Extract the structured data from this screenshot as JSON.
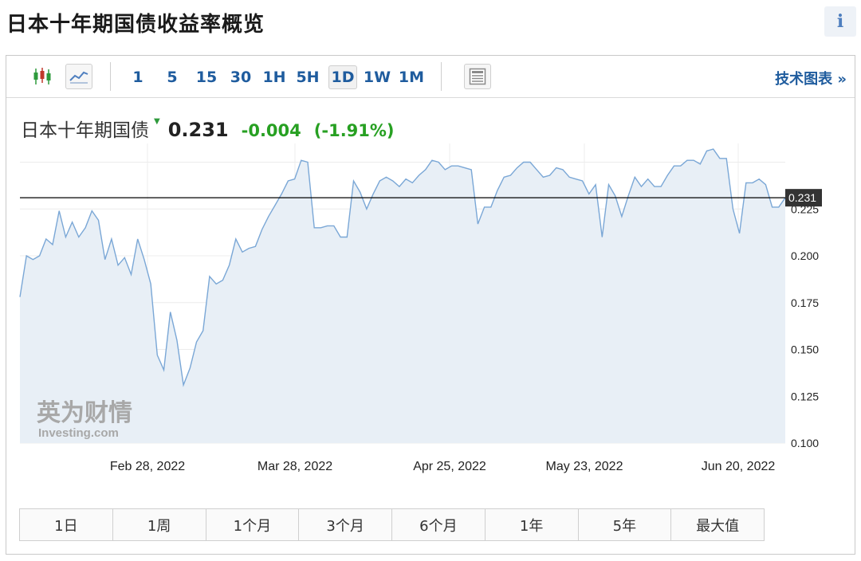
{
  "page": {
    "title": "日本十年期国债收益率概览",
    "info_icon": "i"
  },
  "toolbar": {
    "icons": [
      "candlestick-icon",
      "line-chart-icon",
      "table-view-icon"
    ],
    "timeframes": [
      "1",
      "5",
      "15",
      "30",
      "1H",
      "5H",
      "1D",
      "1W",
      "1M"
    ],
    "active_timeframe": "1D",
    "tech_chart_label": "技术图表 »"
  },
  "quote": {
    "name": "日本十年期国债",
    "price": "0.231",
    "change": "-0.004",
    "change_pct": "(-1.91%)",
    "change_color": "#27a022"
  },
  "chart_data": {
    "type": "area",
    "series": [
      {
        "values": [
          0.178,
          0.2,
          0.198,
          0.2,
          0.209,
          0.206,
          0.224,
          0.21,
          0.218,
          0.21,
          0.215,
          0.224,
          0.219,
          0.198,
          0.209,
          0.195,
          0.199,
          0.19,
          0.209,
          0.198,
          0.185,
          0.147,
          0.139,
          0.17,
          0.155,
          0.131,
          0.14,
          0.154,
          0.16,
          0.189,
          0.185,
          0.187,
          0.195,
          0.209,
          0.202,
          0.204,
          0.205,
          0.214,
          0.221,
          0.227,
          0.233,
          0.24,
          0.241,
          0.251,
          0.25,
          0.215,
          0.215,
          0.216,
          0.216,
          0.21,
          0.21,
          0.24,
          0.234,
          0.225,
          0.233,
          0.24,
          0.242,
          0.24,
          0.237,
          0.241,
          0.239,
          0.243,
          0.246,
          0.251,
          0.25,
          0.246,
          0.248,
          0.248,
          0.247,
          0.246,
          0.217,
          0.226,
          0.226,
          0.235,
          0.242,
          0.243,
          0.247,
          0.25,
          0.25,
          0.246,
          0.242,
          0.243,
          0.247,
          0.246,
          0.242,
          0.241,
          0.24,
          0.233,
          0.238,
          0.21,
          0.238,
          0.232,
          0.221,
          0.232,
          0.242,
          0.237,
          0.241,
          0.237,
          0.237,
          0.243,
          0.248,
          0.248,
          0.251,
          0.251,
          0.249,
          0.256,
          0.257,
          0.252,
          0.252,
          0.225,
          0.212,
          0.239,
          0.239,
          0.241,
          0.238,
          0.226,
          0.226,
          0.231
        ]
      }
    ],
    "last_value": 0.231,
    "last_label": "0.231",
    "ylim": [
      0.1,
      0.26
    ],
    "y_ticks": [
      "0.100",
      "0.125",
      "0.150",
      "0.175",
      "0.200",
      "0.225"
    ],
    "x_tick_labels": [
      "Feb 28, 2022",
      "Mar 28, 2022",
      "Apr 25, 2022",
      "May 23, 2022",
      "Jun 20, 2022"
    ],
    "grid": true,
    "line_color": "#7aa7d6",
    "fill_color": "#e8eff6",
    "price_line_color": "#000000",
    "watermark": {
      "cn": "英为财情",
      "en": "Investing.com"
    }
  },
  "range_buttons": [
    "1日",
    "1周",
    "1个月",
    "3个月",
    "6个月",
    "1年",
    "5年",
    "最大值"
  ]
}
